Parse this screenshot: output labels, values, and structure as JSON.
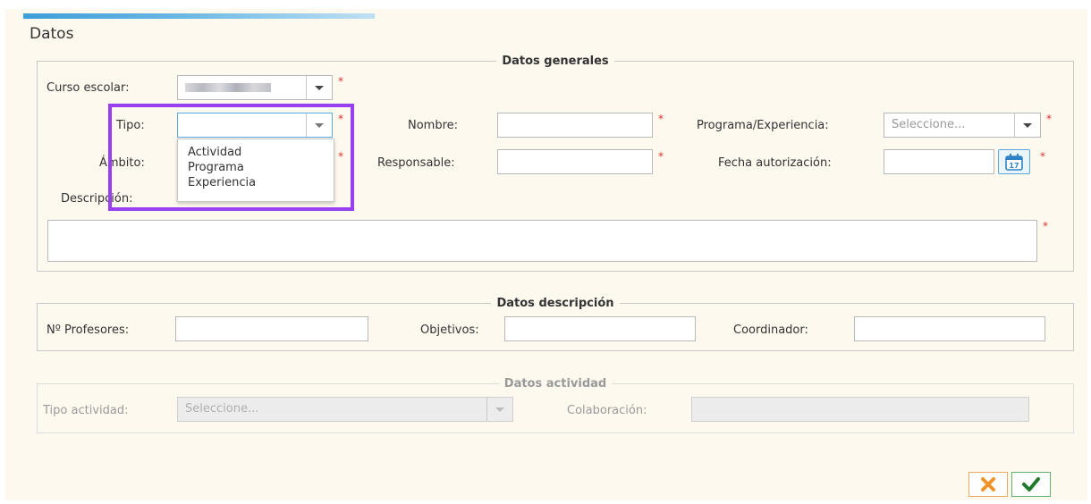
{
  "window": {
    "title": "Datos"
  },
  "general": {
    "legend": "Datos generales",
    "curso_label": "Curso escolar:",
    "tipo_label": "Tipo:",
    "ambito_label": "Ámbito:",
    "descripcion_label": "Descripción:",
    "nombre_label": "Nombre:",
    "responsable_label": "Responsable:",
    "programa_label": "Programa/Experiencia:",
    "programa_placeholder": "Seleccione...",
    "fecha_label": "Fecha autorización:",
    "required_mark": "*"
  },
  "tipo_dropdown": {
    "options": [
      "Actividad",
      "Programa",
      "Experiencia"
    ]
  },
  "descripcion": {
    "legend": "Datos descripción",
    "profesores_label": "Nº Profesores:",
    "objetivos_label": "Objetivos:",
    "coordinador_label": "Coordinador:"
  },
  "actividad": {
    "legend": "Datos actividad",
    "tipo_label": "Tipo actividad:",
    "tipo_placeholder": "Seleccione...",
    "colaboracion_label": "Colaboración:"
  },
  "calendar": {
    "day": "17"
  },
  "colors": {
    "accent": "#3d9ed8",
    "highlight": "#9a3ff0",
    "required": "#e03030",
    "cancel": "#f0932b",
    "ok": "#2e9b3a"
  },
  "icons": {
    "calendar": "calendar-icon",
    "cancel": "cancel-x-icon",
    "ok": "checkmark-icon"
  }
}
